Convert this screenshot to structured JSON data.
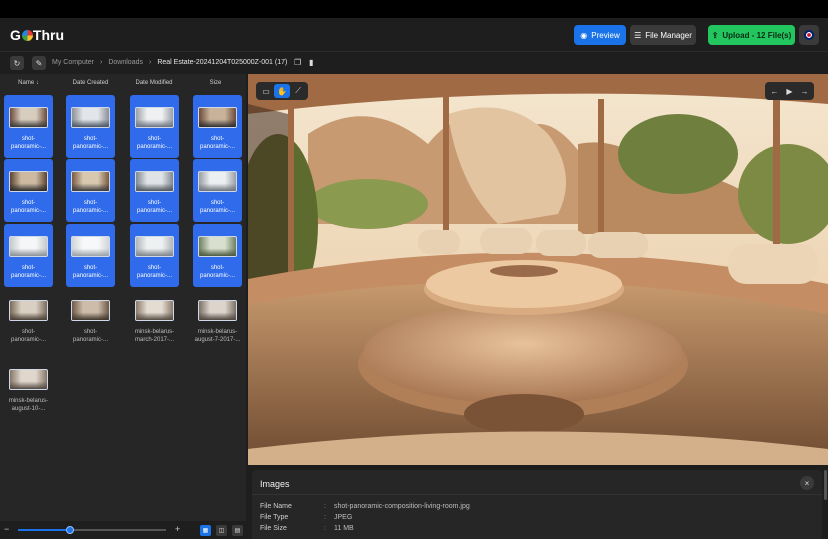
{
  "app": {
    "logo_prefix": "G",
    "logo_suffix": "Thru"
  },
  "header": {
    "preview_label": "Preview",
    "file_manager_label": "File Manager",
    "upload_label": "Upload - 12 File(s)"
  },
  "breadcrumb": {
    "items": [
      "My Computer",
      "Downloads",
      "Real Estate-20241204T025000Z-001 (17)"
    ]
  },
  "columns": {
    "name": "Name",
    "date_created": "Date Created",
    "date_modified": "Date Modified",
    "size": "Size"
  },
  "files": [
    {
      "name1": "shot-",
      "name2": "panoramic-...",
      "selected": true
    },
    {
      "name1": "shot-",
      "name2": "panoramic-...",
      "selected": true
    },
    {
      "name1": "shot-",
      "name2": "panoramic-...",
      "selected": true
    },
    {
      "name1": "shot-",
      "name2": "panoramic-...",
      "selected": true
    },
    {
      "name1": "shot-",
      "name2": "panoramic-...",
      "selected": true
    },
    {
      "name1": "shot-",
      "name2": "panoramic-...",
      "selected": true
    },
    {
      "name1": "shot-",
      "name2": "panoramic-...",
      "selected": true
    },
    {
      "name1": "shot-",
      "name2": "panoramic-...",
      "selected": true
    },
    {
      "name1": "shot-",
      "name2": "panoramic-...",
      "selected": true
    },
    {
      "name1": "shot-",
      "name2": "panoramic-...",
      "selected": true
    },
    {
      "name1": "shot-",
      "name2": "panoramic-...",
      "selected": true
    },
    {
      "name1": "shot-",
      "name2": "panoramic-...",
      "selected": true
    },
    {
      "name1": "shot-",
      "name2": "panoramic-...",
      "selected": false
    },
    {
      "name1": "shot-",
      "name2": "panoramic-...",
      "selected": false
    },
    {
      "name1": "minsk-belarus-",
      "name2": "march-2017-...",
      "selected": false
    },
    {
      "name1": "minsk-belarus-",
      "name2": "august-7-2017-...",
      "selected": false
    },
    {
      "name1": "minsk-belarus-",
      "name2": "august-10-...",
      "selected": false
    }
  ],
  "zoom": {
    "minus": "−",
    "plus": "+",
    "level": 0.35
  },
  "info": {
    "title": "Images",
    "rows": [
      {
        "key": "File Name",
        "sep": ":",
        "value": "shot-panoramic-composition-living-room.jpg"
      },
      {
        "key": "File Type",
        "sep": ":",
        "value": "JPEG"
      },
      {
        "key": "File Size",
        "sep": ":",
        "value": "11 MB"
      }
    ]
  },
  "colors": {
    "accent": "#1a73e8",
    "upload": "#22c55e",
    "selected_tile": "#2f6bea"
  },
  "icons": [
    "refresh-icon",
    "pencil-icon",
    "copy-icon",
    "bookmark-icon",
    "eye-icon",
    "file-manager-icon",
    "upload-icon",
    "flag-uk-icon",
    "image-tool-icon",
    "hand-tool-icon",
    "crop-tool-icon",
    "prev-icon",
    "play-icon",
    "next-icon",
    "close-icon"
  ]
}
